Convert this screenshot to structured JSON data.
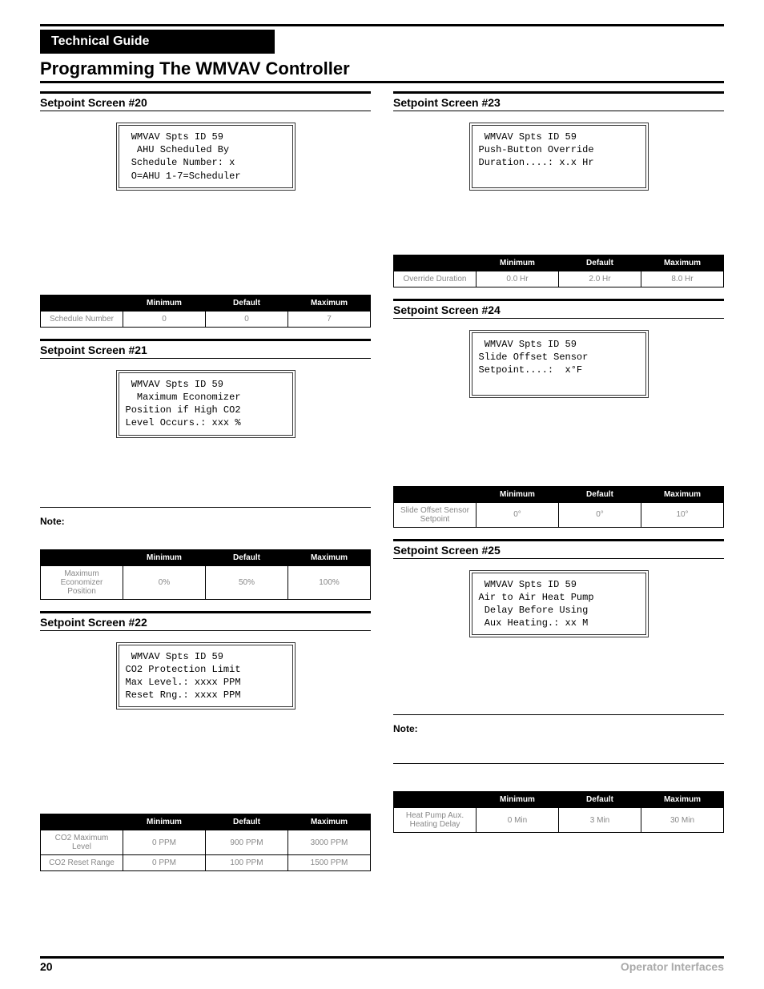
{
  "header": {
    "guide_label": "Technical Guide",
    "title": "Programming The WMVAV Controller"
  },
  "left": {
    "s20": {
      "heading": "Setpoint Screen #20",
      "lcd": " WMVAV Spts ID 59\n  AHU Scheduled By\n Schedule Number: x\n O=AHU 1-7=Scheduler",
      "table": {
        "headers": [
          "",
          "Minimum",
          "Default",
          "Maximum"
        ],
        "rows": [
          [
            "Schedule Number",
            "0",
            "0",
            "7"
          ]
        ]
      }
    },
    "s21": {
      "heading": "Setpoint Screen #21",
      "lcd": " WMVAV Spts ID 59\n  Maximum Economizer\nPosition if High CO2\nLevel Occurs.: xxx %",
      "note_label": "Note:",
      "table": {
        "headers": [
          "",
          "Minimum",
          "Default",
          "Maximum"
        ],
        "rows": [
          [
            "Maximum Economizer Position",
            "0%",
            "50%",
            "100%"
          ]
        ]
      }
    },
    "s22": {
      "heading": "Setpoint Screen #22",
      "lcd": " WMVAV Spts ID 59\nCO2 Protection Limit\nMax Level.: xxxx PPM\nReset Rng.: xxxx PPM",
      "table": {
        "headers": [
          "",
          "Minimum",
          "Default",
          "Maximum"
        ],
        "rows": [
          [
            "CO2 Maximum Level",
            "0 PPM",
            "900 PPM",
            "3000 PPM"
          ],
          [
            "CO2 Reset Range",
            "0 PPM",
            "100 PPM",
            "1500 PPM"
          ]
        ]
      }
    }
  },
  "right": {
    "s23": {
      "heading": "Setpoint Screen #23",
      "lcd": " WMVAV Spts ID 59\nPush-Button Override\nDuration....: x.x Hr\n ",
      "table": {
        "headers": [
          "",
          "Minimum",
          "Default",
          "Maximum"
        ],
        "rows": [
          [
            "Override Duration",
            "0.0 Hr",
            "2.0 Hr",
            "8.0 Hr"
          ]
        ]
      }
    },
    "s24": {
      "heading": "Setpoint Screen #24",
      "lcd": " WMVAV Spts ID 59\nSlide Offset Sensor\nSetpoint....:  x°F\n ",
      "table": {
        "headers": [
          "",
          "Minimum",
          "Default",
          "Maximum"
        ],
        "rows": [
          [
            "Slide Offset Sensor Setpoint",
            "0°",
            "0°",
            "10°"
          ]
        ]
      }
    },
    "s25": {
      "heading": "Setpoint Screen #25",
      "lcd": " WMVAV Spts ID 59\nAir to Air Heat Pump\n Delay Before Using\n Aux Heating.: xx M",
      "note_label": "Note:",
      "table": {
        "headers": [
          "",
          "Minimum",
          "Default",
          "Maximum"
        ],
        "rows": [
          [
            "Heat Pump Aux. Heating Delay",
            "0 Min",
            "3 Min",
            "30 Min"
          ]
        ]
      }
    }
  },
  "footer": {
    "page": "20",
    "doc": "Operator Interfaces"
  }
}
